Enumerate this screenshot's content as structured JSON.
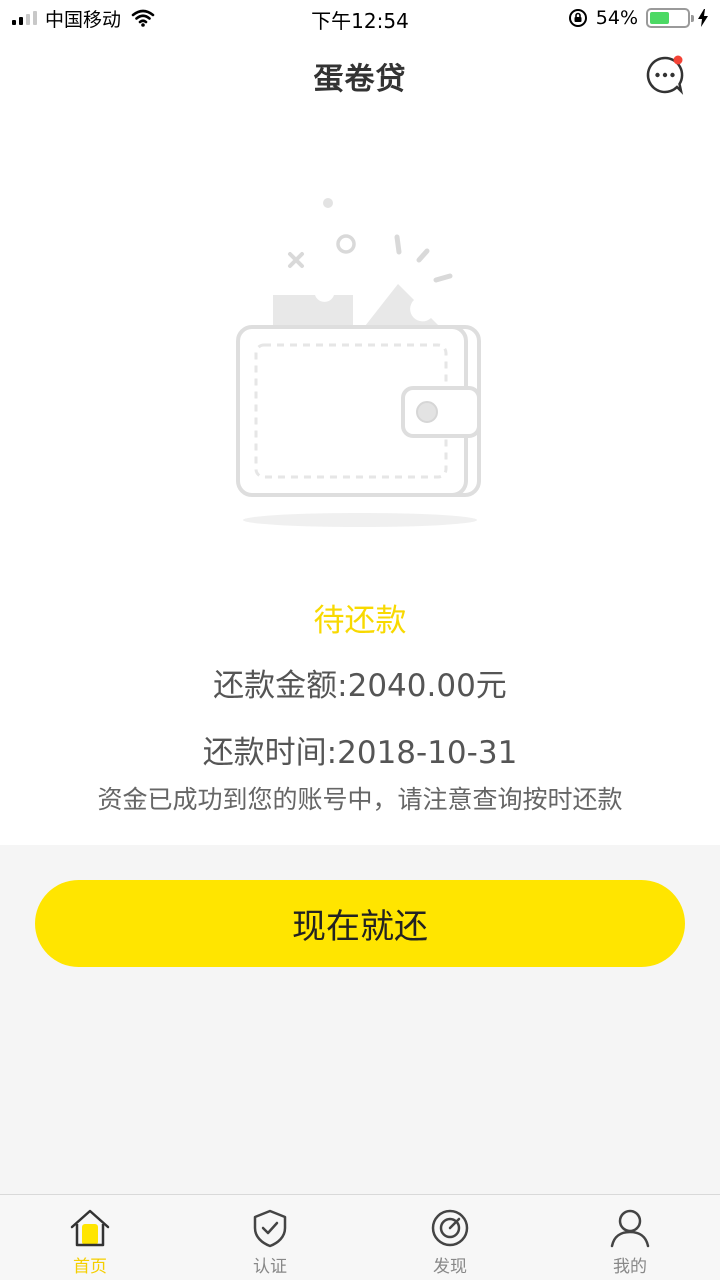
{
  "status_bar": {
    "carrier": "中国移动",
    "time": "下午12:54",
    "battery": "54%",
    "battery_level": 0.54
  },
  "nav": {
    "title": "蛋卷贷",
    "message_icon": "chat-bubble-icon",
    "has_unread_badge": true
  },
  "loan": {
    "status": "待还款",
    "amount_line": "还款金额:2040.00元",
    "date_line": "还款时间:2018-10-31",
    "notice": "资金已成功到您的账号中，请注意查询按时还款"
  },
  "repay_button": {
    "label": "现在就还"
  },
  "tabs": [
    {
      "label": "首页",
      "icon": "home-icon",
      "active": true
    },
    {
      "label": "认证",
      "icon": "shield-check-icon",
      "active": false
    },
    {
      "label": "发现",
      "icon": "compass-icon",
      "active": false
    },
    {
      "label": "我的",
      "icon": "user-icon",
      "active": false
    }
  ],
  "colors": {
    "accent": "#ffe500",
    "status_text": "#f8d900",
    "tab_active": "#f5cf00",
    "badge": "#f44336"
  }
}
